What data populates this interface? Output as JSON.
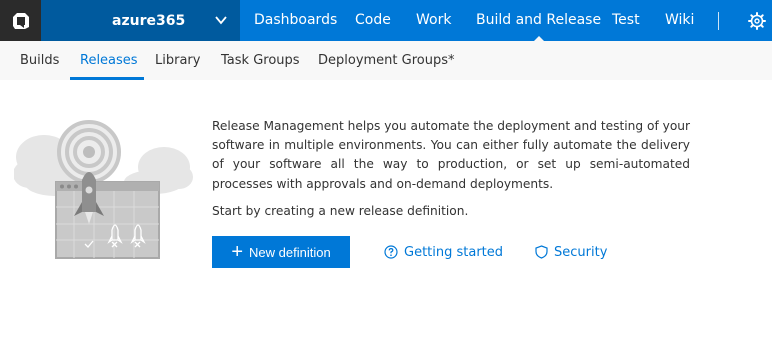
{
  "topbar": {
    "account_name": "azure365",
    "nav": [
      "Dashboards",
      "Code",
      "Work",
      "Build and Release",
      "Test",
      "Wiki"
    ],
    "active_nav": "Build and Release"
  },
  "subnav": {
    "items": [
      "Builds",
      "Releases",
      "Library",
      "Task Groups",
      "Deployment Groups*"
    ],
    "active": "Releases"
  },
  "main": {
    "description": "Release Management helps you automate the deployment and testing of your software in multiple environments. You can either fully automate the delivery of your software all the way to production, or set up semi-automated processes with approvals and on-demand deployments.",
    "start_text": "Start by creating a new release definition.",
    "new_definition_label": "New definition",
    "getting_started_label": "Getting started",
    "security_label": "Security"
  },
  "colors": {
    "accent": "#0078d7",
    "account_bg": "#005a9e",
    "logo_bg": "#2b2b2b",
    "subnav_bg": "#f8f8f8"
  },
  "icons": [
    "vsts-logo-icon",
    "chevron-down-icon",
    "gear-icon",
    "plus-icon",
    "help-circle-icon",
    "shield-icon",
    "release-illustration"
  ]
}
